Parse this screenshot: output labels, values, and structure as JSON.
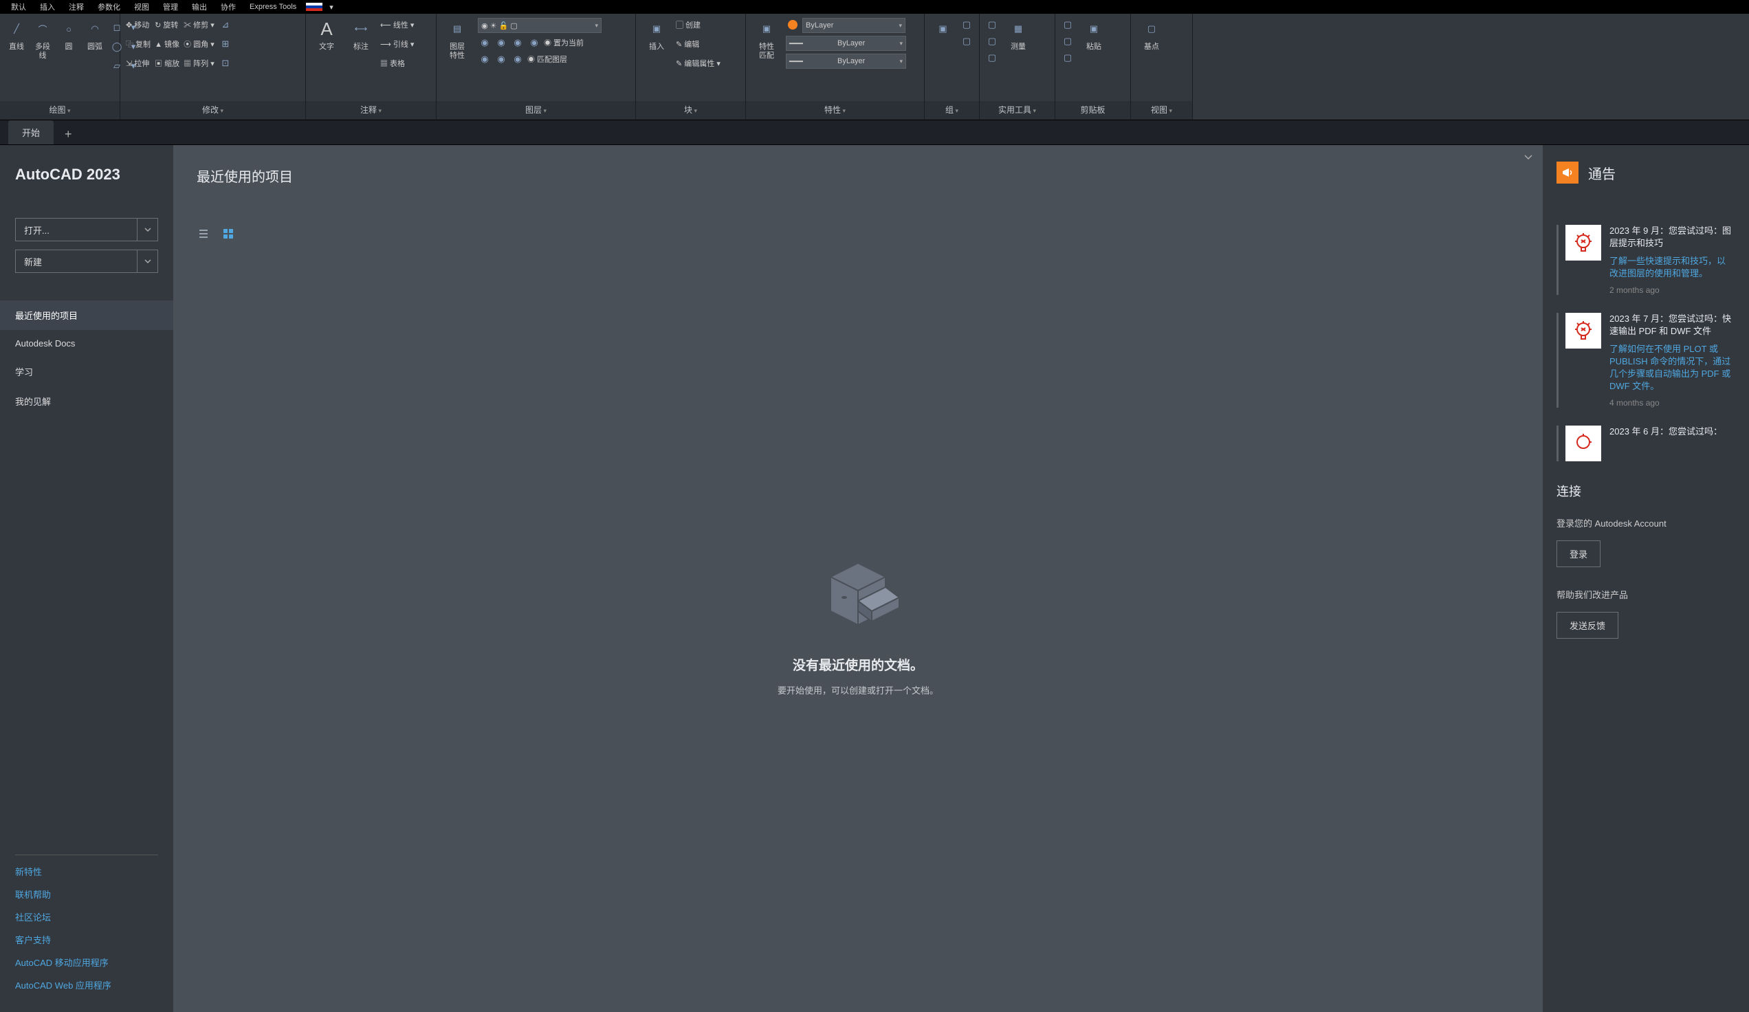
{
  "menubar": [
    "默认",
    "插入",
    "注释",
    "参数化",
    "视图",
    "管理",
    "输出",
    "协作",
    "Express Tools"
  ],
  "ribbon": {
    "panels": [
      {
        "title": "绘图",
        "dd": true,
        "large": [
          {
            "n": "直线",
            "g": "╱"
          },
          {
            "n": "多段线",
            "g": "⌒"
          },
          {
            "n": "圆",
            "g": "○"
          },
          {
            "n": "圆弧",
            "g": "◠"
          }
        ],
        "mini": [
          "◻",
          "◯",
          "◧",
          "▱",
          "◬",
          "⬚"
        ]
      },
      {
        "title": "修改",
        "dd": true,
        "rows": [
          [
            "✥ 移动",
            "↻ 旋转",
            "✂ 修剪 ▾"
          ],
          [
            "⿻ 复制",
            "▲ 镜像",
            "⦿ 圆角 ▾"
          ],
          [
            "⇲ 拉伸",
            "▣ 缩放",
            "▦ 阵列 ▾"
          ]
        ],
        "mini": [
          "⊿",
          "⊞",
          "⊡"
        ]
      },
      {
        "title": "注释",
        "dd": true,
        "large": [
          {
            "n": "文字",
            "g": "A"
          },
          {
            "n": "标注",
            "g": "⟷"
          }
        ],
        "rows": [
          [
            "⟵ 线性 ▾"
          ],
          [
            "⟶ 引线 ▾"
          ],
          [
            "▦ 表格"
          ]
        ]
      },
      {
        "title": "图层",
        "dd": true,
        "large": [
          {
            "n": "图层\n特性",
            "g": "▤"
          }
        ],
        "combo": "",
        "grid": [
          [
            "◉",
            "◉",
            "◉",
            "◉"
          ],
          [
            "◉",
            "◉",
            "◉",
            "◉ 置为当前"
          ],
          [
            "◉",
            "◉",
            "◉",
            "◉ 匹配图层"
          ]
        ]
      },
      {
        "title": "块",
        "dd": true,
        "large": [
          {
            "n": "插入",
            "g": "▣"
          }
        ],
        "rows": [
          [
            "▢ 创建"
          ],
          [
            "✎ 编辑"
          ],
          [
            "✎ 编辑属性 ▾"
          ]
        ]
      },
      {
        "title": "特性",
        "dd": true,
        "large": [
          {
            "n": "特性\n匹配",
            "g": "▣"
          }
        ],
        "color": true,
        "combos": [
          "ByLayer",
          "ByLayer",
          "ByLayer"
        ]
      },
      {
        "title": "组",
        "dd": true,
        "large": [
          {
            "n": "",
            "g": "▣"
          }
        ],
        "mini": [
          "▢",
          "▢"
        ]
      },
      {
        "title": "实用工具",
        "dd": true,
        "large": [
          {
            "n": "测量",
            "g": "▦"
          }
        ],
        "mini": [
          "▢",
          "▢",
          "▢"
        ]
      },
      {
        "title": "剪贴板",
        "large": [
          {
            "n": "粘贴",
            "g": "▣"
          }
        ],
        "mini": [
          "▢",
          "▢",
          "▢"
        ]
      },
      {
        "title": "视图",
        "dd": true,
        "large": [
          {
            "n": "基点",
            "g": "▢"
          }
        ]
      }
    ]
  },
  "filetabs": {
    "active": "开始"
  },
  "sidebar": {
    "appTitle": "AutoCAD 2023",
    "openLabel": "打开...",
    "newLabel": "新建",
    "nav": [
      "最近使用的项目",
      "Autodesk Docs",
      "学习",
      "我的见解"
    ],
    "links": [
      "新特性",
      "联机帮助",
      "社区论坛",
      "客户支持",
      "AutoCAD 移动应用程序",
      "AutoCAD Web 应用程序"
    ]
  },
  "content": {
    "heading": "最近使用的项目",
    "emptyTitle": "没有最近使用的文档。",
    "emptySub": "要开始使用，可以创建或打开一个文档。"
  },
  "right": {
    "heading": "通告",
    "announcements": [
      {
        "title": "2023 年 9 月：您尝试过吗：图层提示和技巧",
        "desc": "了解一些快速提示和技巧，以改进图层的使用和管理。",
        "time": "2 months ago"
      },
      {
        "title": "2023 年 7 月：您尝试过吗：快速输出 PDF 和 DWF 文件",
        "desc": "了解如何在不使用 PLOT 或 PUBLISH 命令的情况下，通过几个步骤或自动输出为 PDF 或 DWF 文件。",
        "time": "4 months ago"
      },
      {
        "title": "2023 年 6 月：您尝试过吗：",
        "desc": "",
        "time": ""
      }
    ],
    "connectHeading": "连接",
    "connectText": "登录您的 Autodesk Account",
    "loginBtn": "登录",
    "improveText": "帮助我们改进产品",
    "feedbackBtn": "发送反馈"
  }
}
